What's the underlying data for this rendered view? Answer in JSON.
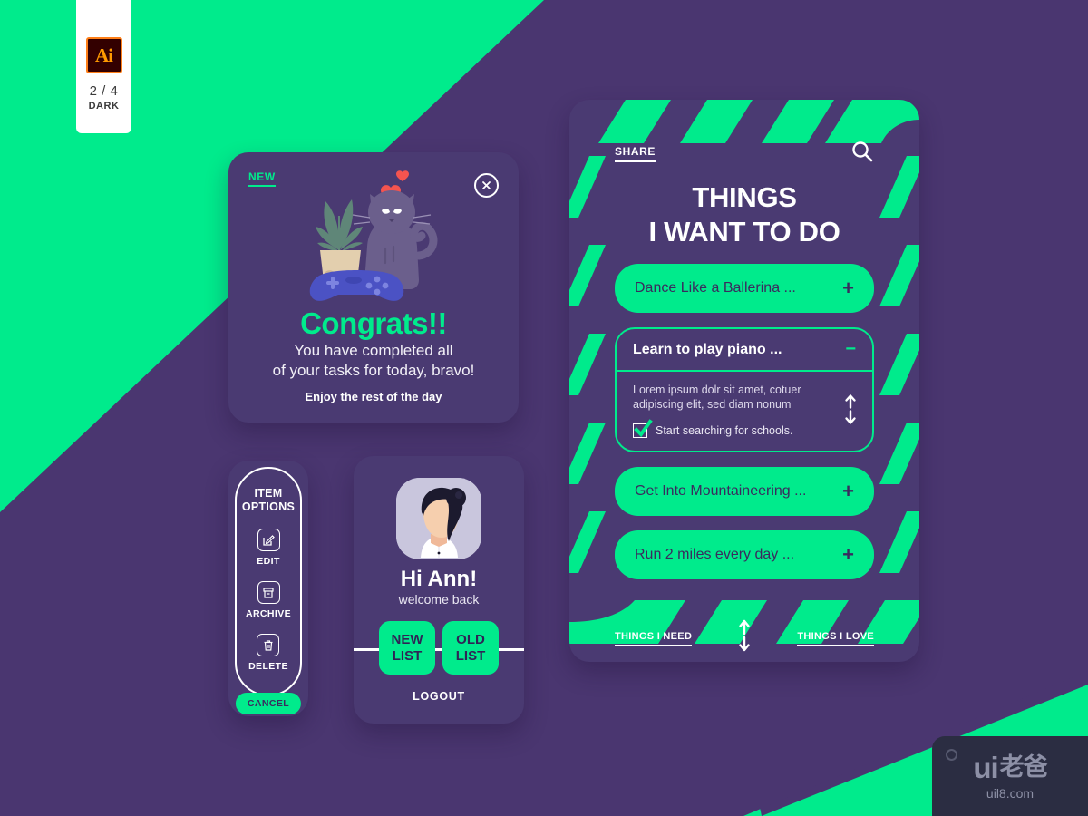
{
  "badge": {
    "app_icon_label": "Ai",
    "count": "2 / 4",
    "mode": "DARK"
  },
  "colors": {
    "green": "#00eb8c",
    "purple": "#4a3a72",
    "deep_purple": "#4a3670",
    "text_light": "#ffffff",
    "card_dark": "#4a3a72"
  },
  "congrats_card": {
    "new_label": "NEW",
    "close_icon": "close-circle-icon",
    "title": "Congrats!!",
    "body_line1": "You have completed all",
    "body_line2": "of your tasks for today, bravo!",
    "footer": "Enjoy the rest of the day",
    "illustration": "cat-plant-gamepad-illustration"
  },
  "item_options": {
    "title_line1": "ITEM",
    "title_line2": "OPTIONS",
    "options": [
      {
        "icon": "edit-icon",
        "label": "EDIT"
      },
      {
        "icon": "archive-icon",
        "label": "ARCHIVE"
      },
      {
        "icon": "trash-icon",
        "label": "DELETE"
      }
    ],
    "cancel_label": "CANCEL"
  },
  "profile_card": {
    "avatar": "user-avatar-illustration",
    "greeting": "Hi Ann!",
    "subtitle": "welcome back",
    "buttons": [
      {
        "line1": "NEW",
        "line2": "LIST"
      },
      {
        "line1": "OLD",
        "line2": "LIST"
      }
    ],
    "logout_label": "LOGOUT"
  },
  "list_card": {
    "share_label": "SHARE",
    "search_icon": "search-icon",
    "title_line1": "THINGS",
    "title_line2": "I WANT TO DO",
    "items": [
      {
        "text": "Dance Like a Ballerina ...",
        "sign": "+",
        "expanded": false
      },
      {
        "text": "Learn to play piano ...",
        "sign": "−",
        "expanded": true
      },
      {
        "text": "Get Into Mountaineering ...",
        "sign": "+",
        "expanded": false
      },
      {
        "text": "Run 2 miles every day ...",
        "sign": "+",
        "expanded": false
      }
    ],
    "expanded_detail": {
      "desc_line1": "Lorem ipsum dolr sit amet, cotuer",
      "desc_line2": "adipiscing elit, sed diam nonum",
      "check_label": "Start searching for schools.",
      "checked": true,
      "scroll_icon": "up-down-arrow-icon"
    },
    "footer": {
      "left_link": "THINGS I NEED",
      "right_link": "THINGS I LOVE",
      "center_icon": "up-down-arrow-icon"
    }
  },
  "watermark": {
    "logo_latin": "ui",
    "logo_cn": "老爸",
    "url": "uil8.com"
  }
}
